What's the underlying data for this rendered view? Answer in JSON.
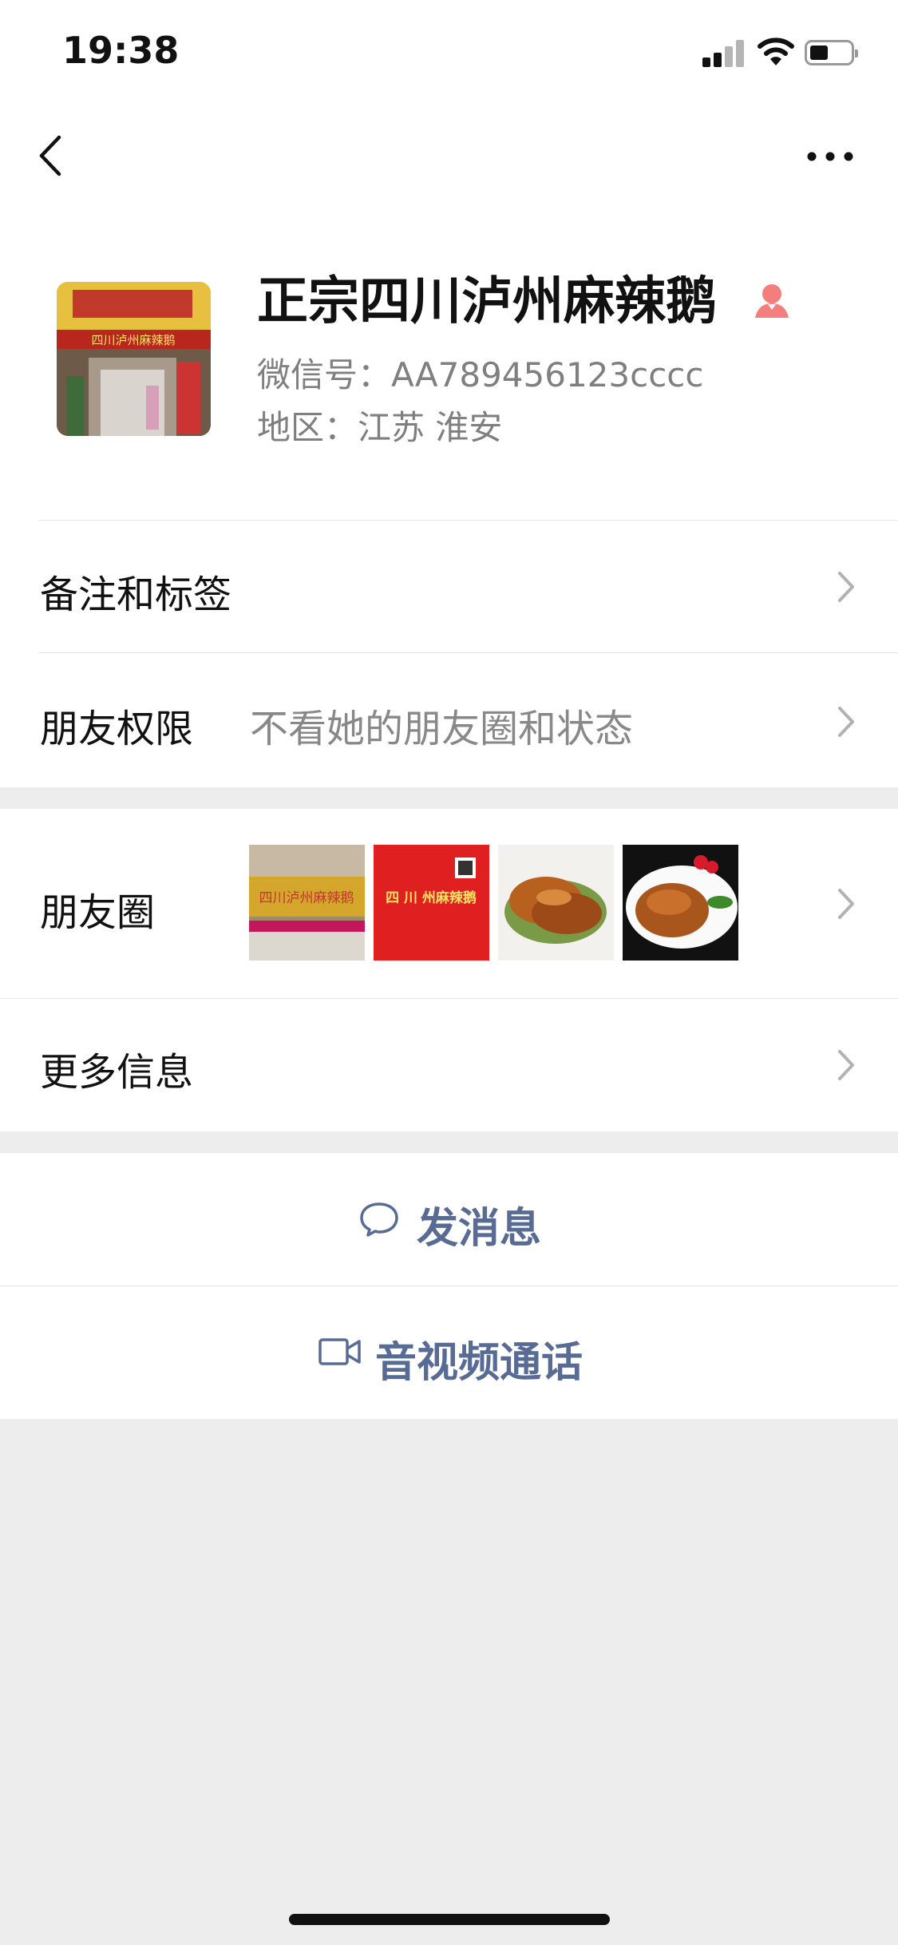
{
  "status_bar": {
    "time": "19:38"
  },
  "profile": {
    "name": "正宗四川泸州麻辣鹅",
    "wechat_id": "微信号：AA789456123cccc",
    "region": "地区：江苏 淮安",
    "gender_icon": "female-person-icon",
    "accent_color": "#f37e7d"
  },
  "rows": {
    "remarks_tags": {
      "label": "备注和标签"
    },
    "friend_permissions": {
      "label": "朋友权限",
      "value": "不看她的朋友圈和状态"
    },
    "moments": {
      "label": "朋友圈",
      "thumbnails": [
        {
          "text": "四川泸州麻辣鹅"
        },
        {
          "text": "四 川 州麻辣鹅"
        },
        {
          "text": ""
        },
        {
          "text": ""
        }
      ]
    },
    "more_info": {
      "label": "更多信息"
    }
  },
  "actions": {
    "send_message": "发消息",
    "video_call": "音视频通话"
  },
  "colors": {
    "link": "#576b95",
    "background": "#ededed",
    "card": "#ffffff"
  }
}
